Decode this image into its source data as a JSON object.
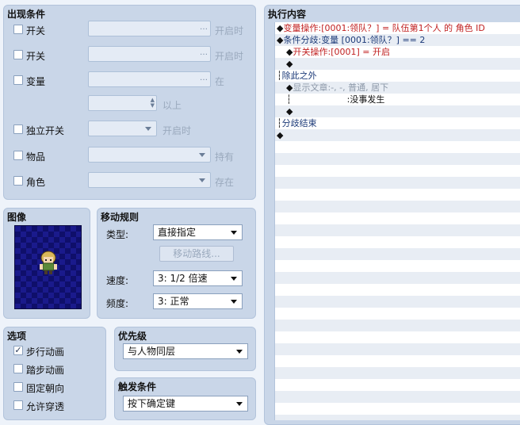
{
  "appear": {
    "title": "出现条件",
    "switch1": {
      "label": "开关",
      "value": "",
      "hint": "开启时"
    },
    "switch2": {
      "label": "开关",
      "value": "",
      "hint": "开启时"
    },
    "variable": {
      "label": "变量",
      "value": "",
      "hint": "在",
      "min_value": "",
      "min_hint": "以上"
    },
    "self_switch": {
      "label": "独立开关",
      "value": "",
      "hint": "开启时"
    },
    "item": {
      "label": "物品",
      "value": "",
      "hint": "持有"
    },
    "actor": {
      "label": "角色",
      "value": "",
      "hint": "存在"
    },
    "dots": "…"
  },
  "image": {
    "title": "图像"
  },
  "move": {
    "title": "移动规则",
    "type_label": "类型:",
    "type_value": "直接指定",
    "route_button": "移动路线...",
    "speed_label": "速度:",
    "speed_value": "3: 1/2 倍速",
    "freq_label": "频度:",
    "freq_value": "3: 正常"
  },
  "options": {
    "title": "选项",
    "items": [
      {
        "label": "步行动画",
        "checked": true
      },
      {
        "label": "踏步动画",
        "checked": false
      },
      {
        "label": "固定朝向",
        "checked": false
      },
      {
        "label": "允许穿透",
        "checked": false
      }
    ]
  },
  "priority": {
    "title": "优先级",
    "value": "与人物同层"
  },
  "trigger": {
    "title": "触发条件",
    "value": "按下确定键"
  },
  "contents": {
    "title": "执行内容",
    "lines": [
      {
        "prefix": "◆",
        "name": "变量操作",
        "sep": ":",
        "text": "[0001:领队？] = 队伍第1个人 的 角色 ID",
        "color": "red",
        "indent": 0
      },
      {
        "prefix": "◆",
        "name": "条件分歧",
        "sep": ":",
        "text": "变量 [0001:领队？] == 2",
        "color": "blue",
        "indent": 0
      },
      {
        "prefix": "◆",
        "name": "开关操作",
        "sep": ":",
        "text": "[0001] = 开启",
        "color": "red",
        "indent": 1
      },
      {
        "prefix": "◆",
        "name": "",
        "sep": "",
        "text": "",
        "color": "",
        "indent": 1
      },
      {
        "prefix": "┆",
        "name": "除此之外",
        "sep": "",
        "text": "",
        "color": "blue",
        "indent": 0
      },
      {
        "prefix": "◆",
        "name": "显示文章",
        "sep": ":",
        "text": "-, -, 普通, 居下",
        "color": "gray",
        "indent": 1
      },
      {
        "prefix": "┆",
        "name": "",
        "sep": ":",
        "text": "没事发生",
        "color": "",
        "indent": 1
      },
      {
        "prefix": "◆",
        "name": "",
        "sep": "",
        "text": "",
        "color": "",
        "indent": 1
      },
      {
        "prefix": "┆",
        "name": "分歧结束",
        "sep": "",
        "text": "",
        "color": "blue",
        "indent": 0
      },
      {
        "prefix": "◆",
        "name": "",
        "sep": "",
        "text": "",
        "color": "",
        "indent": 0
      }
    ]
  },
  "colors": {
    "panel": "#c9d6e8",
    "red_text": "#c02020",
    "blue_text": "#1c3a78"
  }
}
